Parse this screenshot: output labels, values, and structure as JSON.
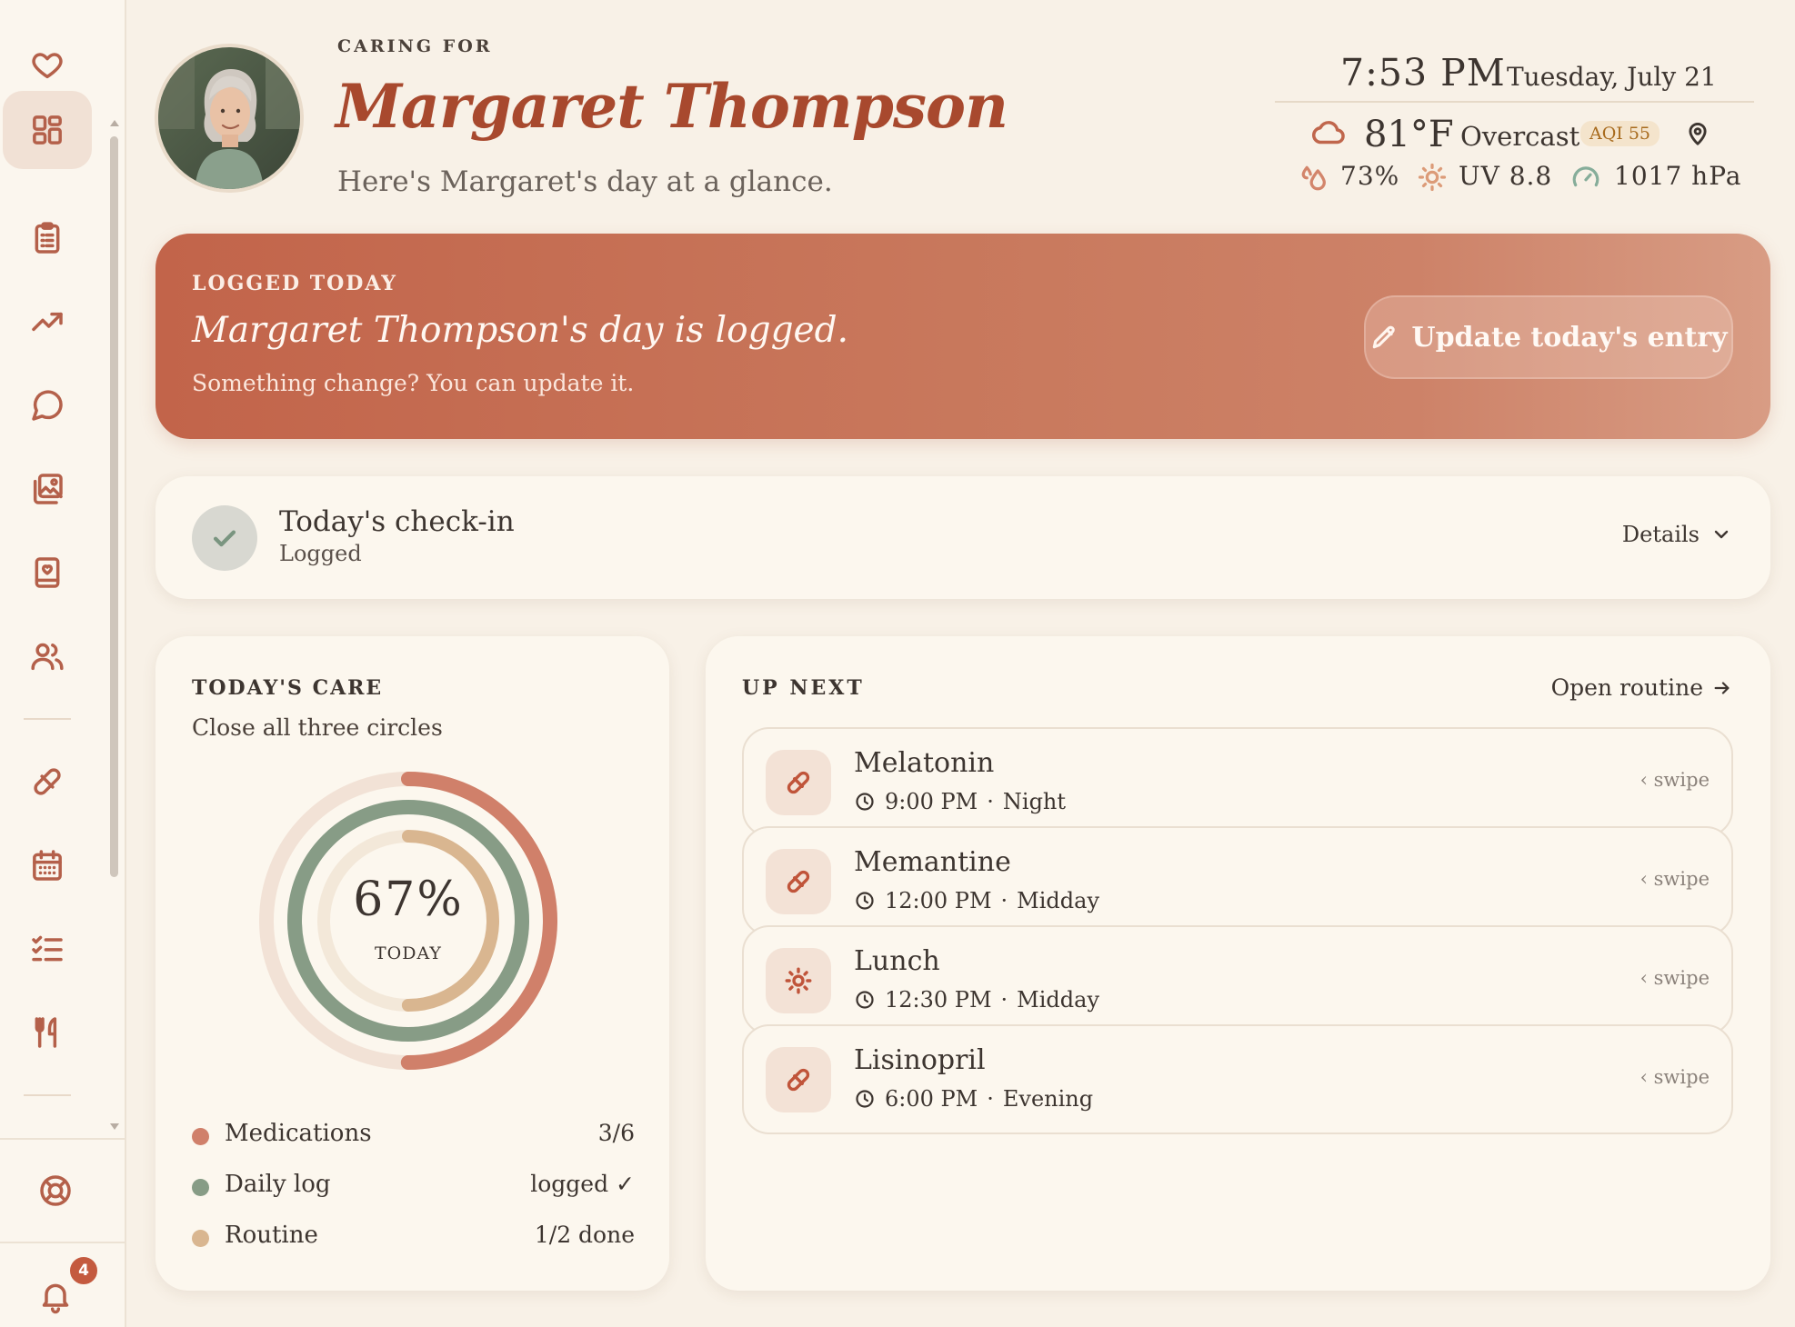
{
  "sidebar": {
    "notifications_count": "4"
  },
  "header": {
    "eyebrow": "CARING FOR",
    "name": "Margaret Thompson",
    "subtitle": "Here's Margaret's day at a glance."
  },
  "clock": {
    "time": "7:53 PM",
    "date": "Tuesday, July 21"
  },
  "weather": {
    "temperature": "81°F",
    "condition": "Overcast",
    "aqi": "AQI 55",
    "humidity": "73%",
    "uv": "UV 8.8",
    "pressure": "1017 hPa"
  },
  "banner": {
    "eyebrow": "LOGGED TODAY",
    "title": "Margaret Thompson's day is logged.",
    "subtitle": "Something change? You can update it.",
    "button_label": "Update today's entry"
  },
  "checkin": {
    "title": "Today's check-in",
    "status": "Logged",
    "details_label": "Details"
  },
  "care": {
    "eyebrow": "TODAY'S CARE",
    "subtitle": "Close all three circles",
    "percent": "67%",
    "percent_label": "TODAY",
    "rings": [
      {
        "name": "Medications",
        "progress": 0.5,
        "color": "#d0806a",
        "track": "#f2e2d6"
      },
      {
        "name": "Daily log",
        "progress": 1.0,
        "color": "#879c86",
        "track": "#e5e6dc"
      },
      {
        "name": "Routine",
        "progress": 0.5,
        "color": "#d9b690",
        "track": "#f3e8d9"
      }
    ],
    "legend": [
      {
        "name": "Medications",
        "value": "3/6",
        "color": "#d0806a"
      },
      {
        "name": "Daily log",
        "value": "logged ✓",
        "color": "#879c86"
      },
      {
        "name": "Routine",
        "value": "1/2 done",
        "color": "#d9b690"
      }
    ]
  },
  "upnext": {
    "eyebrow": "UP NEXT",
    "open_label": "Open routine",
    "items": [
      {
        "name": "Melatonin",
        "time": "9:00 PM",
        "period": "Night",
        "icon": "pill-icon",
        "swipe": "‹ swipe"
      },
      {
        "name": "Memantine",
        "time": "12:00 PM",
        "period": "Midday",
        "icon": "pill-icon",
        "swipe": "‹ swipe"
      },
      {
        "name": "Lunch",
        "time": "12:30 PM",
        "period": "Midday",
        "icon": "sun-icon",
        "swipe": "‹ swipe"
      },
      {
        "name": "Lisinopril",
        "time": "6:00 PM",
        "period": "Evening",
        "icon": "pill-icon",
        "swipe": "‹ swipe"
      }
    ]
  },
  "colors": {
    "accent": "#a8492e",
    "background": "#f8f1e7",
    "card": "#fcf7ee"
  }
}
